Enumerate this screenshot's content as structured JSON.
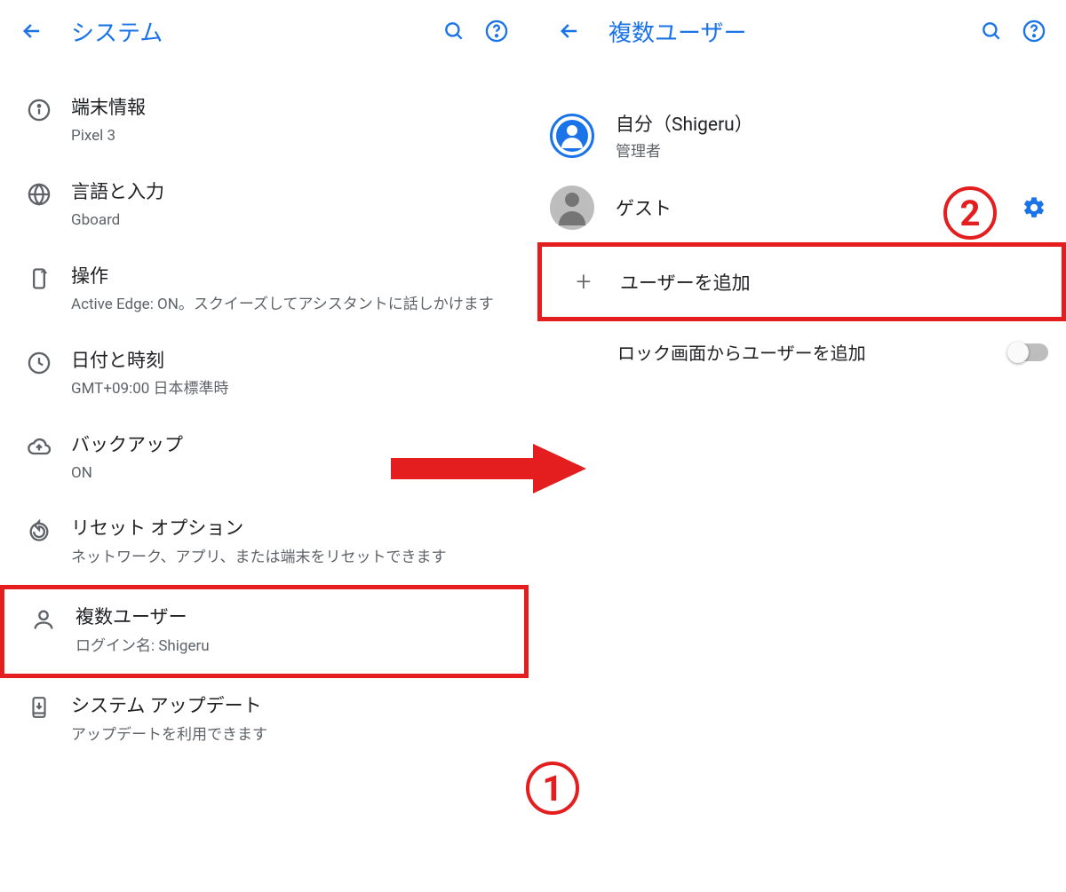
{
  "left": {
    "title": "システム",
    "items": [
      {
        "title": "端末情報",
        "sub": "Pixel 3"
      },
      {
        "title": "言語と入力",
        "sub": "Gboard"
      },
      {
        "title": "操作",
        "sub": "Active Edge: ON。スクイーズしてアシスタントに話しかけます"
      },
      {
        "title": "日付と時刻",
        "sub": "GMT+09:00 日本標準時"
      },
      {
        "title": "バックアップ",
        "sub": "ON"
      },
      {
        "title": "リセット オプション",
        "sub": "ネットワーク、アプリ、または端末をリセットできます"
      },
      {
        "title": "複数ユーザー",
        "sub": "ログイン名: Shigeru"
      },
      {
        "title": "システム アップデート",
        "sub": "アップデートを利用できます"
      }
    ]
  },
  "right": {
    "title": "複数ユーザー",
    "self": {
      "title": "自分（Shigeru）",
      "sub": "管理者"
    },
    "guest": {
      "title": "ゲスト"
    },
    "add": "ユーザーを追加",
    "lockscreen": "ロック画面からユーザーを追加"
  },
  "annotations": {
    "num1": "1",
    "num2": "2"
  }
}
